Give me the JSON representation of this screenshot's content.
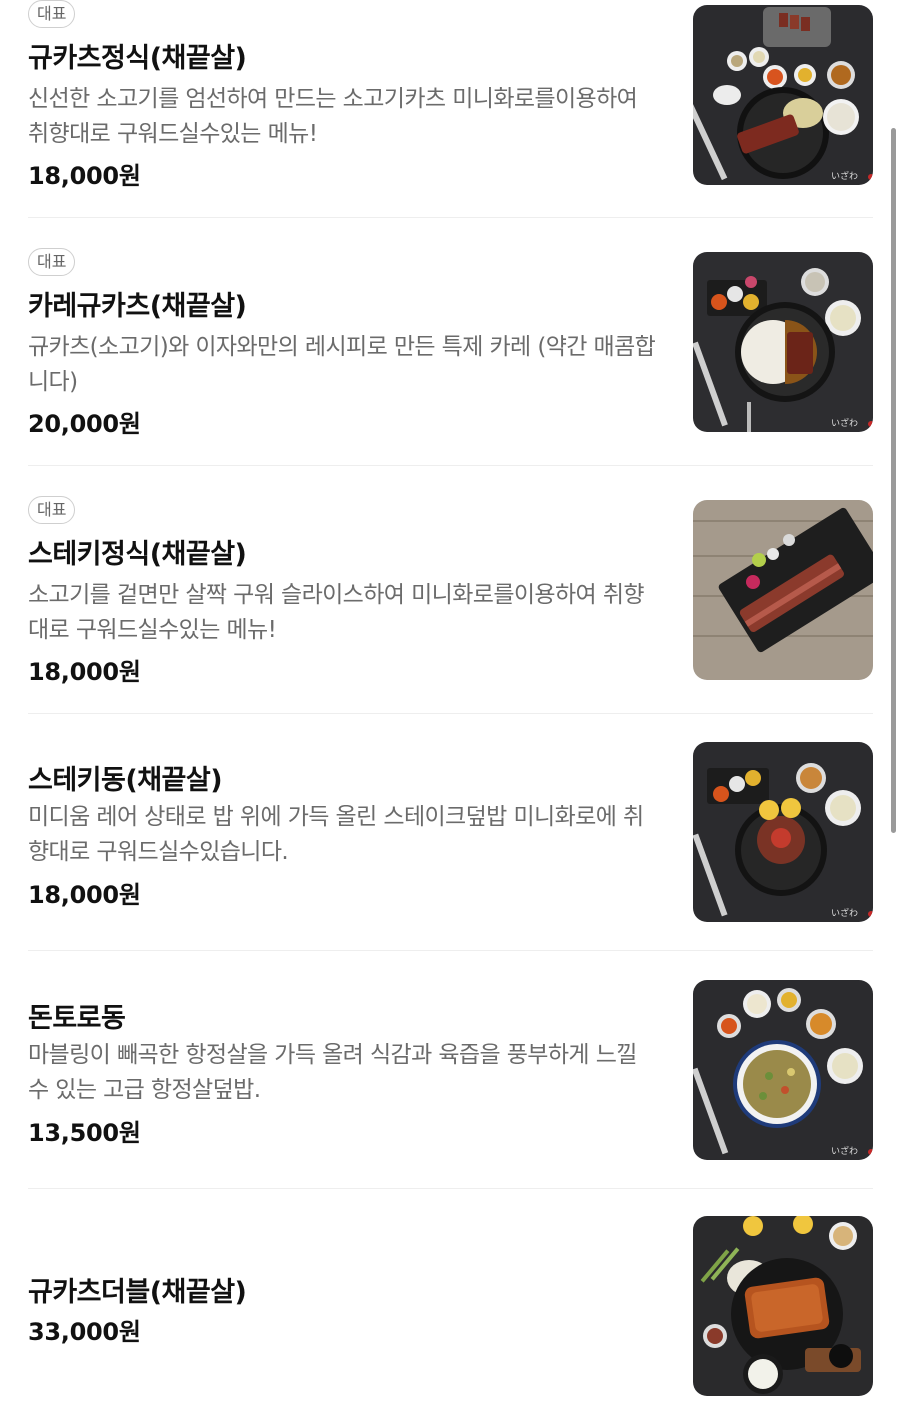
{
  "menu": {
    "items": [
      {
        "badge": "대표",
        "name": "규카츠정식(채끝살)",
        "description": "신선한 소고기를 엄선하여 만드는 소고기카츠 미니화로를이용하여 취향대로 구워드실수있는 메뉴!",
        "price": "18,000원",
        "image": "gyukatsu-set-photo"
      },
      {
        "badge": "대표",
        "name": "카레규카츠(채끝살)",
        "description": "규카츠(소고기)와 이자와만의 레시피로 만든 특제 카레 (약간 매콤합니다)",
        "price": "20,000원",
        "image": "curry-gyukatsu-photo"
      },
      {
        "badge": "대표",
        "name": "스테키정식(채끝살)",
        "description": "소고기를 겉면만 살짝 구워 슬라이스하여 미니화로를이용하여 취향대로 구워드실수있는 메뉴!",
        "price": "18,000원",
        "image": "steak-set-photo"
      },
      {
        "badge": "",
        "name": "스테키동(채끝살)",
        "description": "미디움 레어 상태로 밥 위에 가득 올린 스테이크덮밥 미니화로에 취향대로 구워드실수있습니다.",
        "price": "18,000원",
        "image": "steak-don-photo"
      },
      {
        "badge": "",
        "name": "돈토로동",
        "description": "마블링이 빼곡한 항정살을 가득 올려 식감과 육즙을 풍부하게 느낄 수 있는 고급 항정살덮밥.",
        "price": "13,500원",
        "image": "tontoro-don-photo"
      },
      {
        "badge": "",
        "name": "규카츠더블(채끝살)",
        "description": "",
        "price": "33,000원",
        "image": "gyukatsu-double-photo"
      }
    ]
  },
  "photo_watermark": "いざわ",
  "colors": {
    "text": "#111111",
    "description": "#6b6b6b",
    "badge_border": "#cfcfcf",
    "divider": "#eeeeee",
    "dark_table": "#2b2b2e",
    "wood_table": "#a59a8c"
  }
}
